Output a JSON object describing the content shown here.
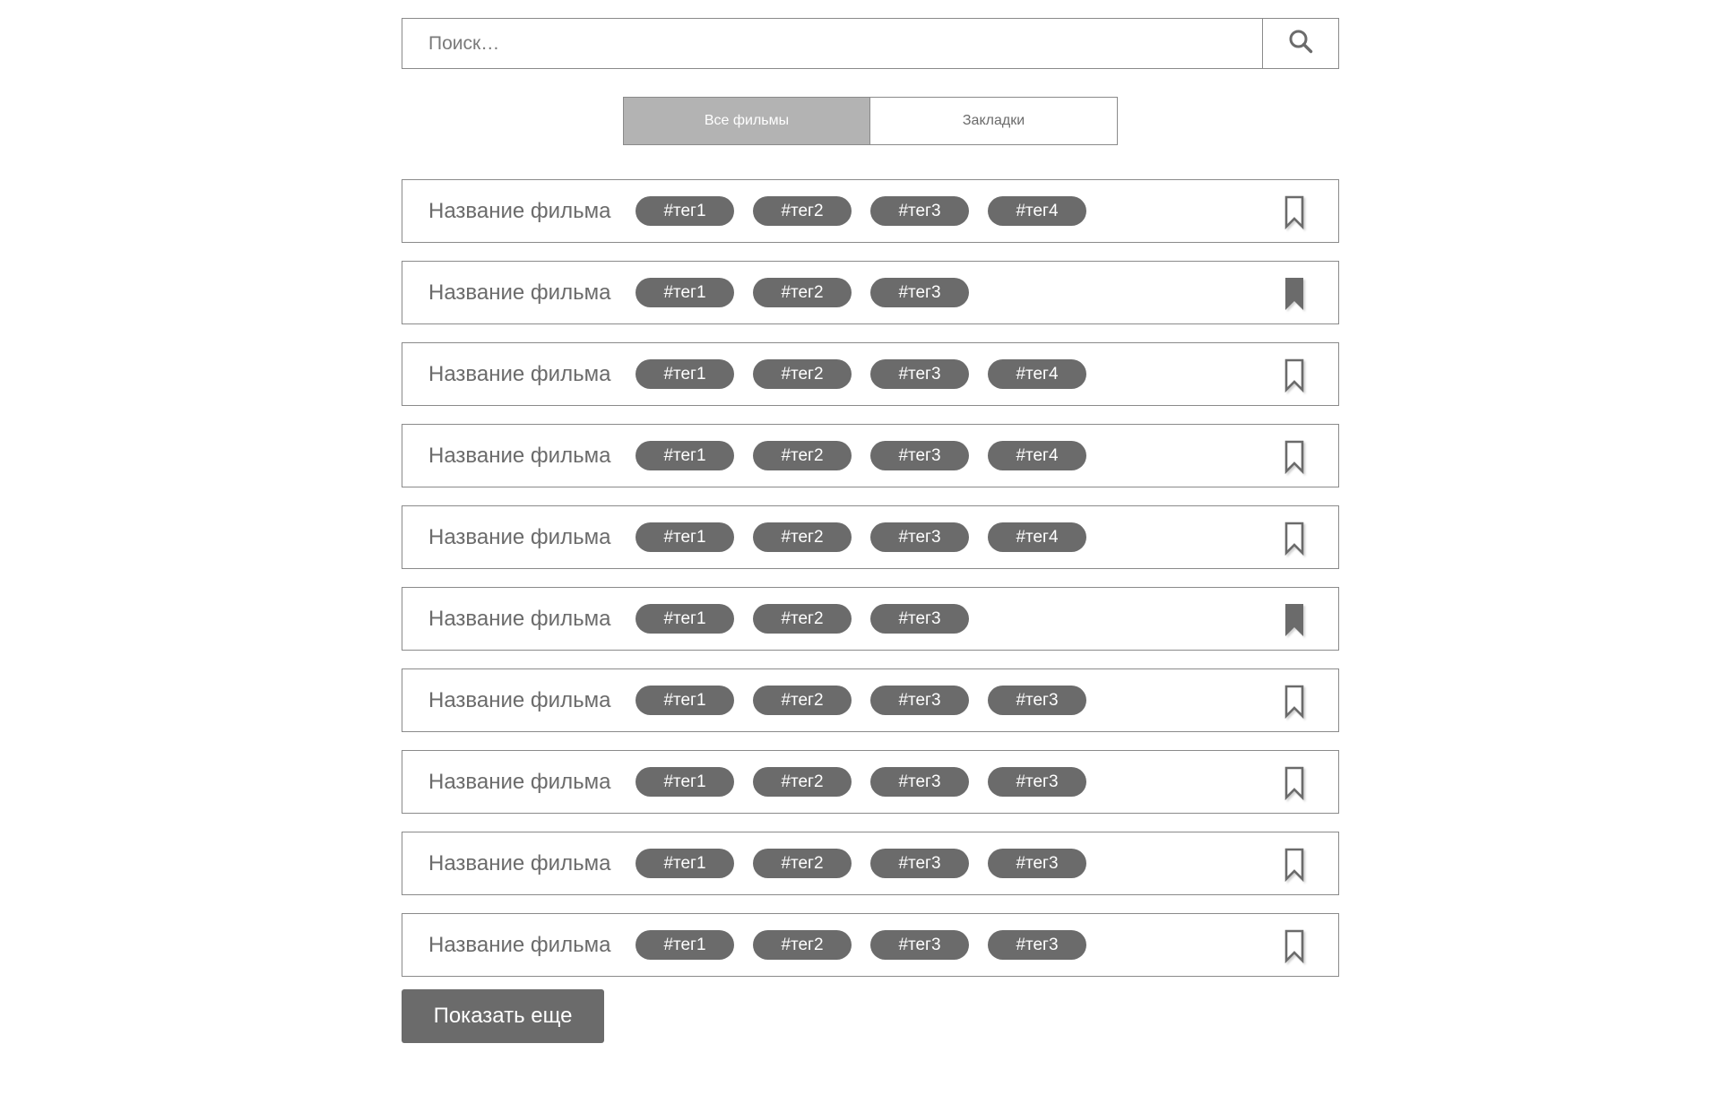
{
  "search": {
    "placeholder": "Поиск…",
    "icon": "search-icon"
  },
  "tabs": [
    {
      "label": "Все фильмы",
      "active": true
    },
    {
      "label": "Закладки",
      "active": false
    }
  ],
  "films": [
    {
      "title": "Название фильма",
      "tags": [
        "#тег1",
        "#тег2",
        "#тег3",
        "#тег4"
      ],
      "bookmarked": false
    },
    {
      "title": "Название фильма",
      "tags": [
        "#тег1",
        "#тег2",
        "#тег3"
      ],
      "bookmarked": true
    },
    {
      "title": "Название фильма",
      "tags": [
        "#тег1",
        "#тег2",
        "#тег3",
        "#тег4"
      ],
      "bookmarked": false
    },
    {
      "title": "Название фильма",
      "tags": [
        "#тег1",
        "#тег2",
        "#тег3",
        "#тег4"
      ],
      "bookmarked": false
    },
    {
      "title": "Название фильма",
      "tags": [
        "#тег1",
        "#тег2",
        "#тег3",
        "#тег4"
      ],
      "bookmarked": false
    },
    {
      "title": "Название фильма",
      "tags": [
        "#тег1",
        "#тег2",
        "#тег3"
      ],
      "bookmarked": true
    },
    {
      "title": "Название фильма",
      "tags": [
        "#тег1",
        "#тег2",
        "#тег3",
        "#тег3"
      ],
      "bookmarked": false
    },
    {
      "title": "Название фильма",
      "tags": [
        "#тег1",
        "#тег2",
        "#тег3",
        "#тег3"
      ],
      "bookmarked": false
    },
    {
      "title": "Название фильма",
      "tags": [
        "#тег1",
        "#тег2",
        "#тег3",
        "#тег3"
      ],
      "bookmarked": false
    },
    {
      "title": "Название фильма",
      "tags": [
        "#тег1",
        "#тег2",
        "#тег3",
        "#тег3"
      ],
      "bookmarked": false
    }
  ],
  "more_button": {
    "label": "Показать еще"
  },
  "colors": {
    "border": "#8a8a8a",
    "tag_bg": "#6b6b6b",
    "tab_active_bg": "#b3b3b3",
    "text": "#6b6b6b"
  }
}
